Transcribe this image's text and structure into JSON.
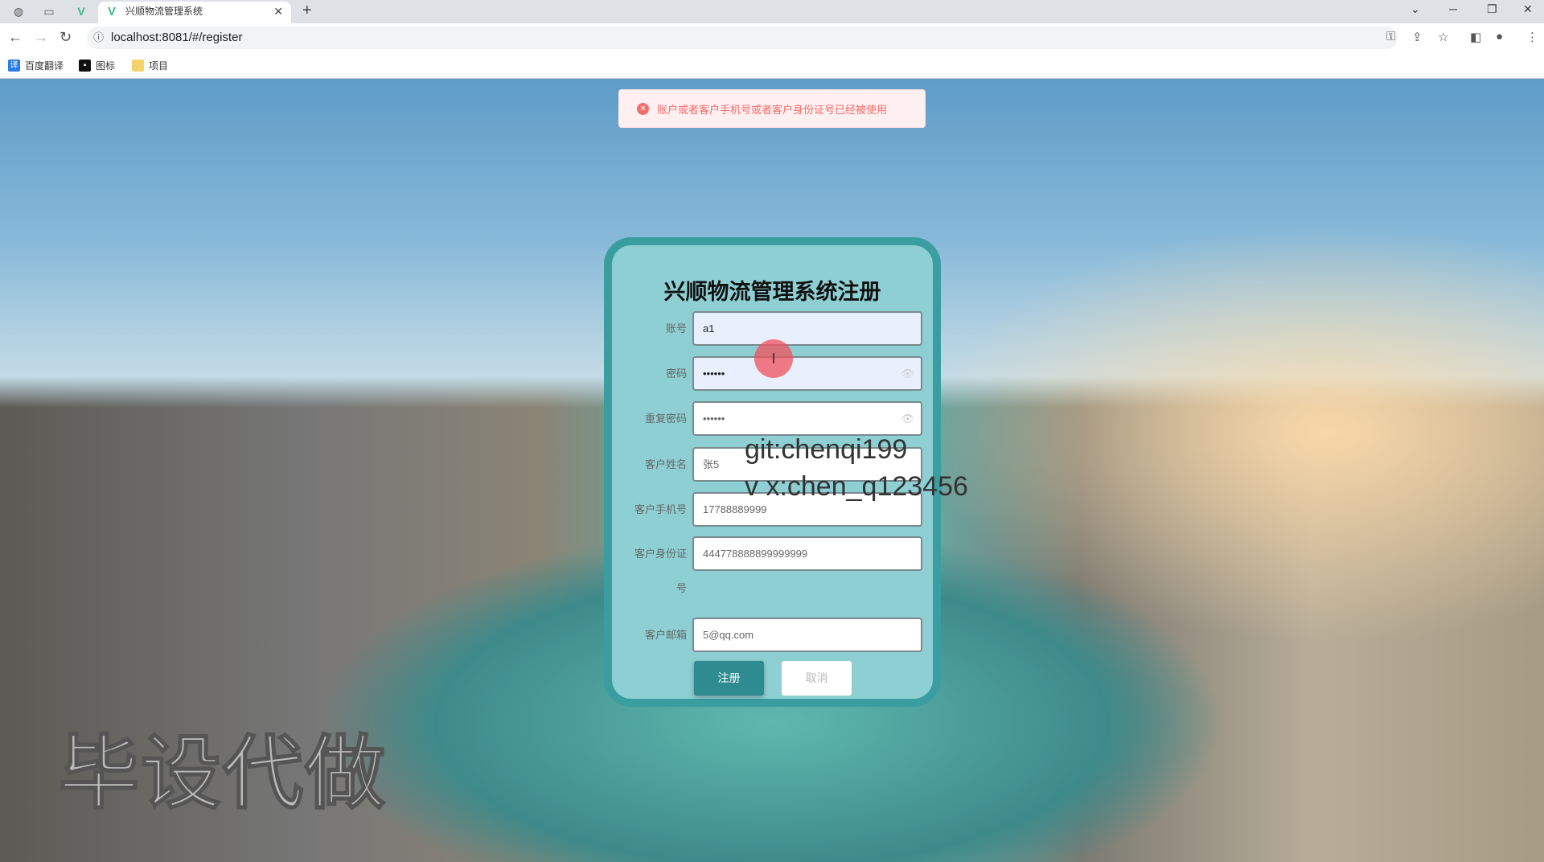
{
  "browser": {
    "tab_title": "兴顺物流管理系统",
    "url": "localhost:8081/#/register",
    "bookmarks": [
      {
        "label": "百度翻译"
      },
      {
        "label": "图标"
      },
      {
        "label": "项目"
      }
    ]
  },
  "message": {
    "type": "error",
    "text": "账户或者客户手机号或者客户身份证号已经被使用",
    "color": "#f56c6c"
  },
  "form": {
    "title": "兴顺物流管理系统注册",
    "fields": [
      {
        "label": "账号",
        "value": "a1"
      },
      {
        "label": "密码",
        "value": "••••••"
      },
      {
        "label": "重复密码",
        "value": "••••••"
      },
      {
        "label": "客户姓名",
        "value": "张5"
      },
      {
        "label": "客户手机号",
        "value": "17788889999"
      },
      {
        "label": "客户身份证号",
        "value": "444778888899999999"
      },
      {
        "label": "客户邮箱",
        "value": "5@qq.com"
      }
    ],
    "submit_label": "注册",
    "cancel_label": "取消"
  },
  "watermarks": {
    "big": "毕设代做",
    "git": "git:chenqi199",
    "wx": "v x:chen_q123456"
  },
  "colors": {
    "card_bg": "#8ecfd3",
    "card_border": "#3a9ea1",
    "primary": "#2e8b90"
  }
}
